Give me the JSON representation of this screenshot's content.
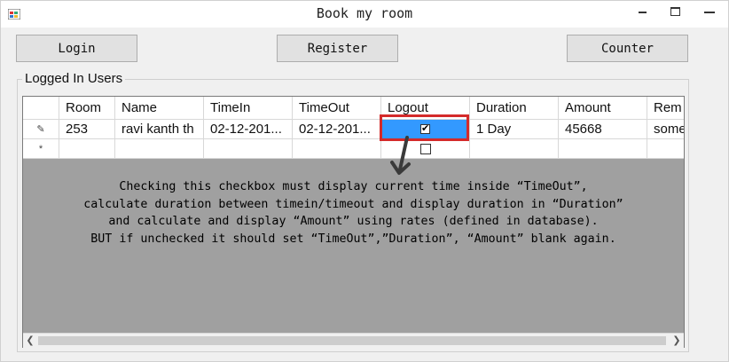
{
  "window": {
    "title": "Book my room",
    "icon": "form-icon"
  },
  "toolbar": {
    "login_label": "Login",
    "register_label": "Register",
    "counter_label": "Counter"
  },
  "group": {
    "label": "Logged In Users"
  },
  "grid": {
    "columns": [
      "Room",
      "Name",
      "TimeIn",
      "TimeOut",
      "Logout",
      "Duration",
      "Amount",
      "Rem"
    ],
    "rows": [
      {
        "row_marker": "✎",
        "room": "253",
        "name": "ravi kanth th",
        "time_in": "02-12-201...",
        "time_out": "02-12-201...",
        "logout_checked": true,
        "duration": "1 Day",
        "amount": "45668",
        "remarks": "some"
      }
    ],
    "new_row_marker": "*",
    "new_row_logout_checked": false,
    "selection_color": "#3399ff"
  },
  "annotation": {
    "highlight_color": "#d42a2a",
    "lines": [
      "Checking this checkbox must display current time inside “TimeOut”,",
      "calculate duration between timein/timeout and display duration in “Duration”",
      "and calculate and display “Amount” using rates (defined in database).",
      "BUT if unchecked it should set “TimeOut”,”Duration”, “Amount” blank again."
    ]
  }
}
